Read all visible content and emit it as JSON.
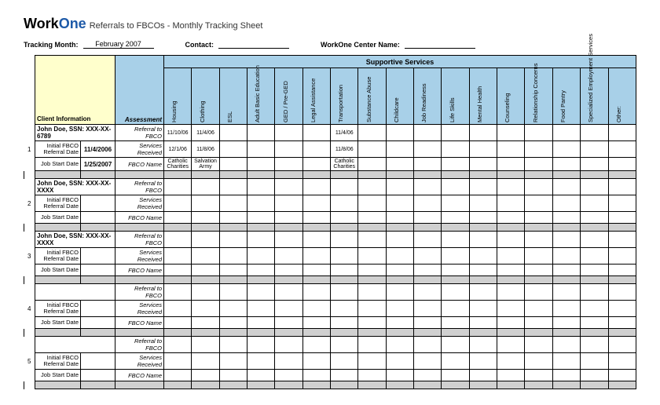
{
  "logo": {
    "part1": "Work",
    "part2": "One"
  },
  "title": "Referrals to FBCOs - Monthly Tracking Sheet",
  "meta": {
    "month_label": "Tracking Month:",
    "month_value": "February 2007",
    "contact_label": "Contact:",
    "contact_value": "",
    "center_label": "WorkOne Center Name:",
    "center_value": ""
  },
  "headers": {
    "super": "Supportive Services",
    "client_info": "Client Information",
    "assessment": "Assessment",
    "cols": [
      "Housing",
      "Clothing",
      "ESL",
      "Adult Basic Education",
      "GED / Pre-GED",
      "Legal Assistance",
      "Transportation",
      "Substance Abuse",
      "Childcare",
      "Job Readiness",
      "Life Skills",
      "Mental Health",
      "Counseling",
      "Relationship Concerns",
      "Food Pantry",
      "Specialized Employment Services",
      "Other:"
    ]
  },
  "row_labels": {
    "initial": "Initial FBCO Referral Date",
    "jobstart": "Job Start Date",
    "assess": [
      "Referral to FBCO",
      "Services Received",
      "FBCO Name"
    ]
  },
  "clients": [
    {
      "num": "1",
      "name": "John Doe, SSN: XXX-XX-6789",
      "referral_date": "11/4/2006",
      "jobstart_date": "1/25/2007",
      "rows": [
        [
          "11/10/06",
          "11/4/06",
          "",
          "",
          "",
          "",
          "11/4/06",
          "",
          "",
          "",
          "",
          "",
          "",
          "",
          "",
          "",
          ""
        ],
        [
          "12/1/06",
          "11/8/06",
          "",
          "",
          "",
          "",
          "11/8/06",
          "",
          "",
          "",
          "",
          "",
          "",
          "",
          "",
          "",
          ""
        ],
        [
          "Catholic Charities",
          "Salvation Army",
          "",
          "",
          "",
          "",
          "Catholic Charities",
          "",
          "",
          "",
          "",
          "",
          "",
          "",
          "",
          "",
          ""
        ]
      ]
    },
    {
      "num": "2",
      "name": "John Doe, SSN: XXX-XX-XXXX",
      "referral_date": "",
      "jobstart_date": "",
      "rows": [
        [
          "",
          "",
          "",
          "",
          "",
          "",
          "",
          "",
          "",
          "",
          "",
          "",
          "",
          "",
          "",
          "",
          ""
        ],
        [
          "",
          "",
          "",
          "",
          "",
          "",
          "",
          "",
          "",
          "",
          "",
          "",
          "",
          "",
          "",
          "",
          ""
        ],
        [
          "",
          "",
          "",
          "",
          "",
          "",
          "",
          "",
          "",
          "",
          "",
          "",
          "",
          "",
          "",
          "",
          ""
        ]
      ]
    },
    {
      "num": "3",
      "name": "John Doe, SSN: XXX-XX-XXXX",
      "referral_date": "",
      "jobstart_date": "",
      "rows": [
        [
          "",
          "",
          "",
          "",
          "",
          "",
          "",
          "",
          "",
          "",
          "",
          "",
          "",
          "",
          "",
          "",
          ""
        ],
        [
          "",
          "",
          "",
          "",
          "",
          "",
          "",
          "",
          "",
          "",
          "",
          "",
          "",
          "",
          "",
          "",
          ""
        ],
        [
          "",
          "",
          "",
          "",
          "",
          "",
          "",
          "",
          "",
          "",
          "",
          "",
          "",
          "",
          "",
          "",
          ""
        ]
      ]
    },
    {
      "num": "4",
      "name": "",
      "referral_date": "",
      "jobstart_date": "",
      "rows": [
        [
          "",
          "",
          "",
          "",
          "",
          "",
          "",
          "",
          "",
          "",
          "",
          "",
          "",
          "",
          "",
          "",
          ""
        ],
        [
          "",
          "",
          "",
          "",
          "",
          "",
          "",
          "",
          "",
          "",
          "",
          "",
          "",
          "",
          "",
          "",
          ""
        ],
        [
          "",
          "",
          "",
          "",
          "",
          "",
          "",
          "",
          "",
          "",
          "",
          "",
          "",
          "",
          "",
          "",
          ""
        ]
      ]
    },
    {
      "num": "5",
      "name": "",
      "referral_date": "",
      "jobstart_date": "",
      "rows": [
        [
          "",
          "",
          "",
          "",
          "",
          "",
          "",
          "",
          "",
          "",
          "",
          "",
          "",
          "",
          "",
          "",
          ""
        ],
        [
          "",
          "",
          "",
          "",
          "",
          "",
          "",
          "",
          "",
          "",
          "",
          "",
          "",
          "",
          "",
          "",
          ""
        ],
        [
          "",
          "",
          "",
          "",
          "",
          "",
          "",
          "",
          "",
          "",
          "",
          "",
          "",
          "",
          "",
          "",
          ""
        ]
      ]
    }
  ]
}
